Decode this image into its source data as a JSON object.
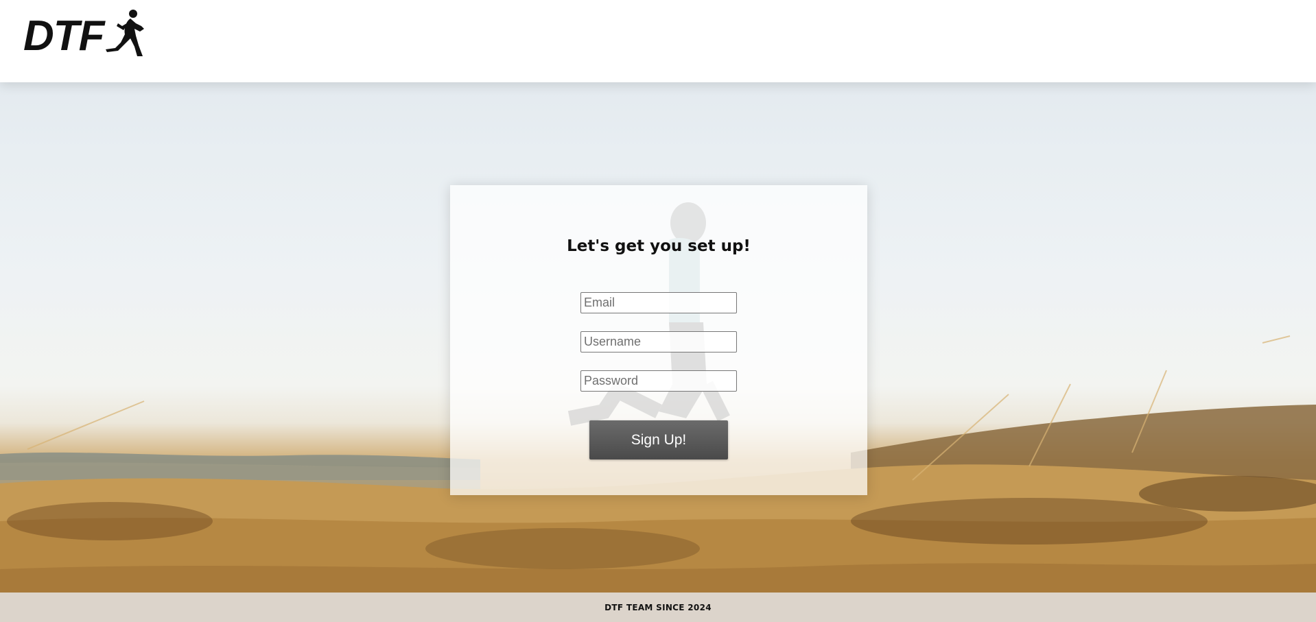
{
  "header": {
    "logo_text": "DTF",
    "logo_icon": "runner-icon"
  },
  "signup_card": {
    "title": "Let's get you set up!",
    "email_placeholder": "Email",
    "username_placeholder": "Username",
    "password_placeholder": "Password",
    "submit_label": "Sign Up!"
  },
  "footer": {
    "text": "DTF TEAM SINCE 2024"
  },
  "background": {
    "description_icon": "runner-field-photo"
  },
  "colors": {
    "header_bg": "#ffffff",
    "button_bg": "#555555",
    "button_text": "#ffffff",
    "grass": "#c49a56",
    "sky": "#e8eef2"
  }
}
